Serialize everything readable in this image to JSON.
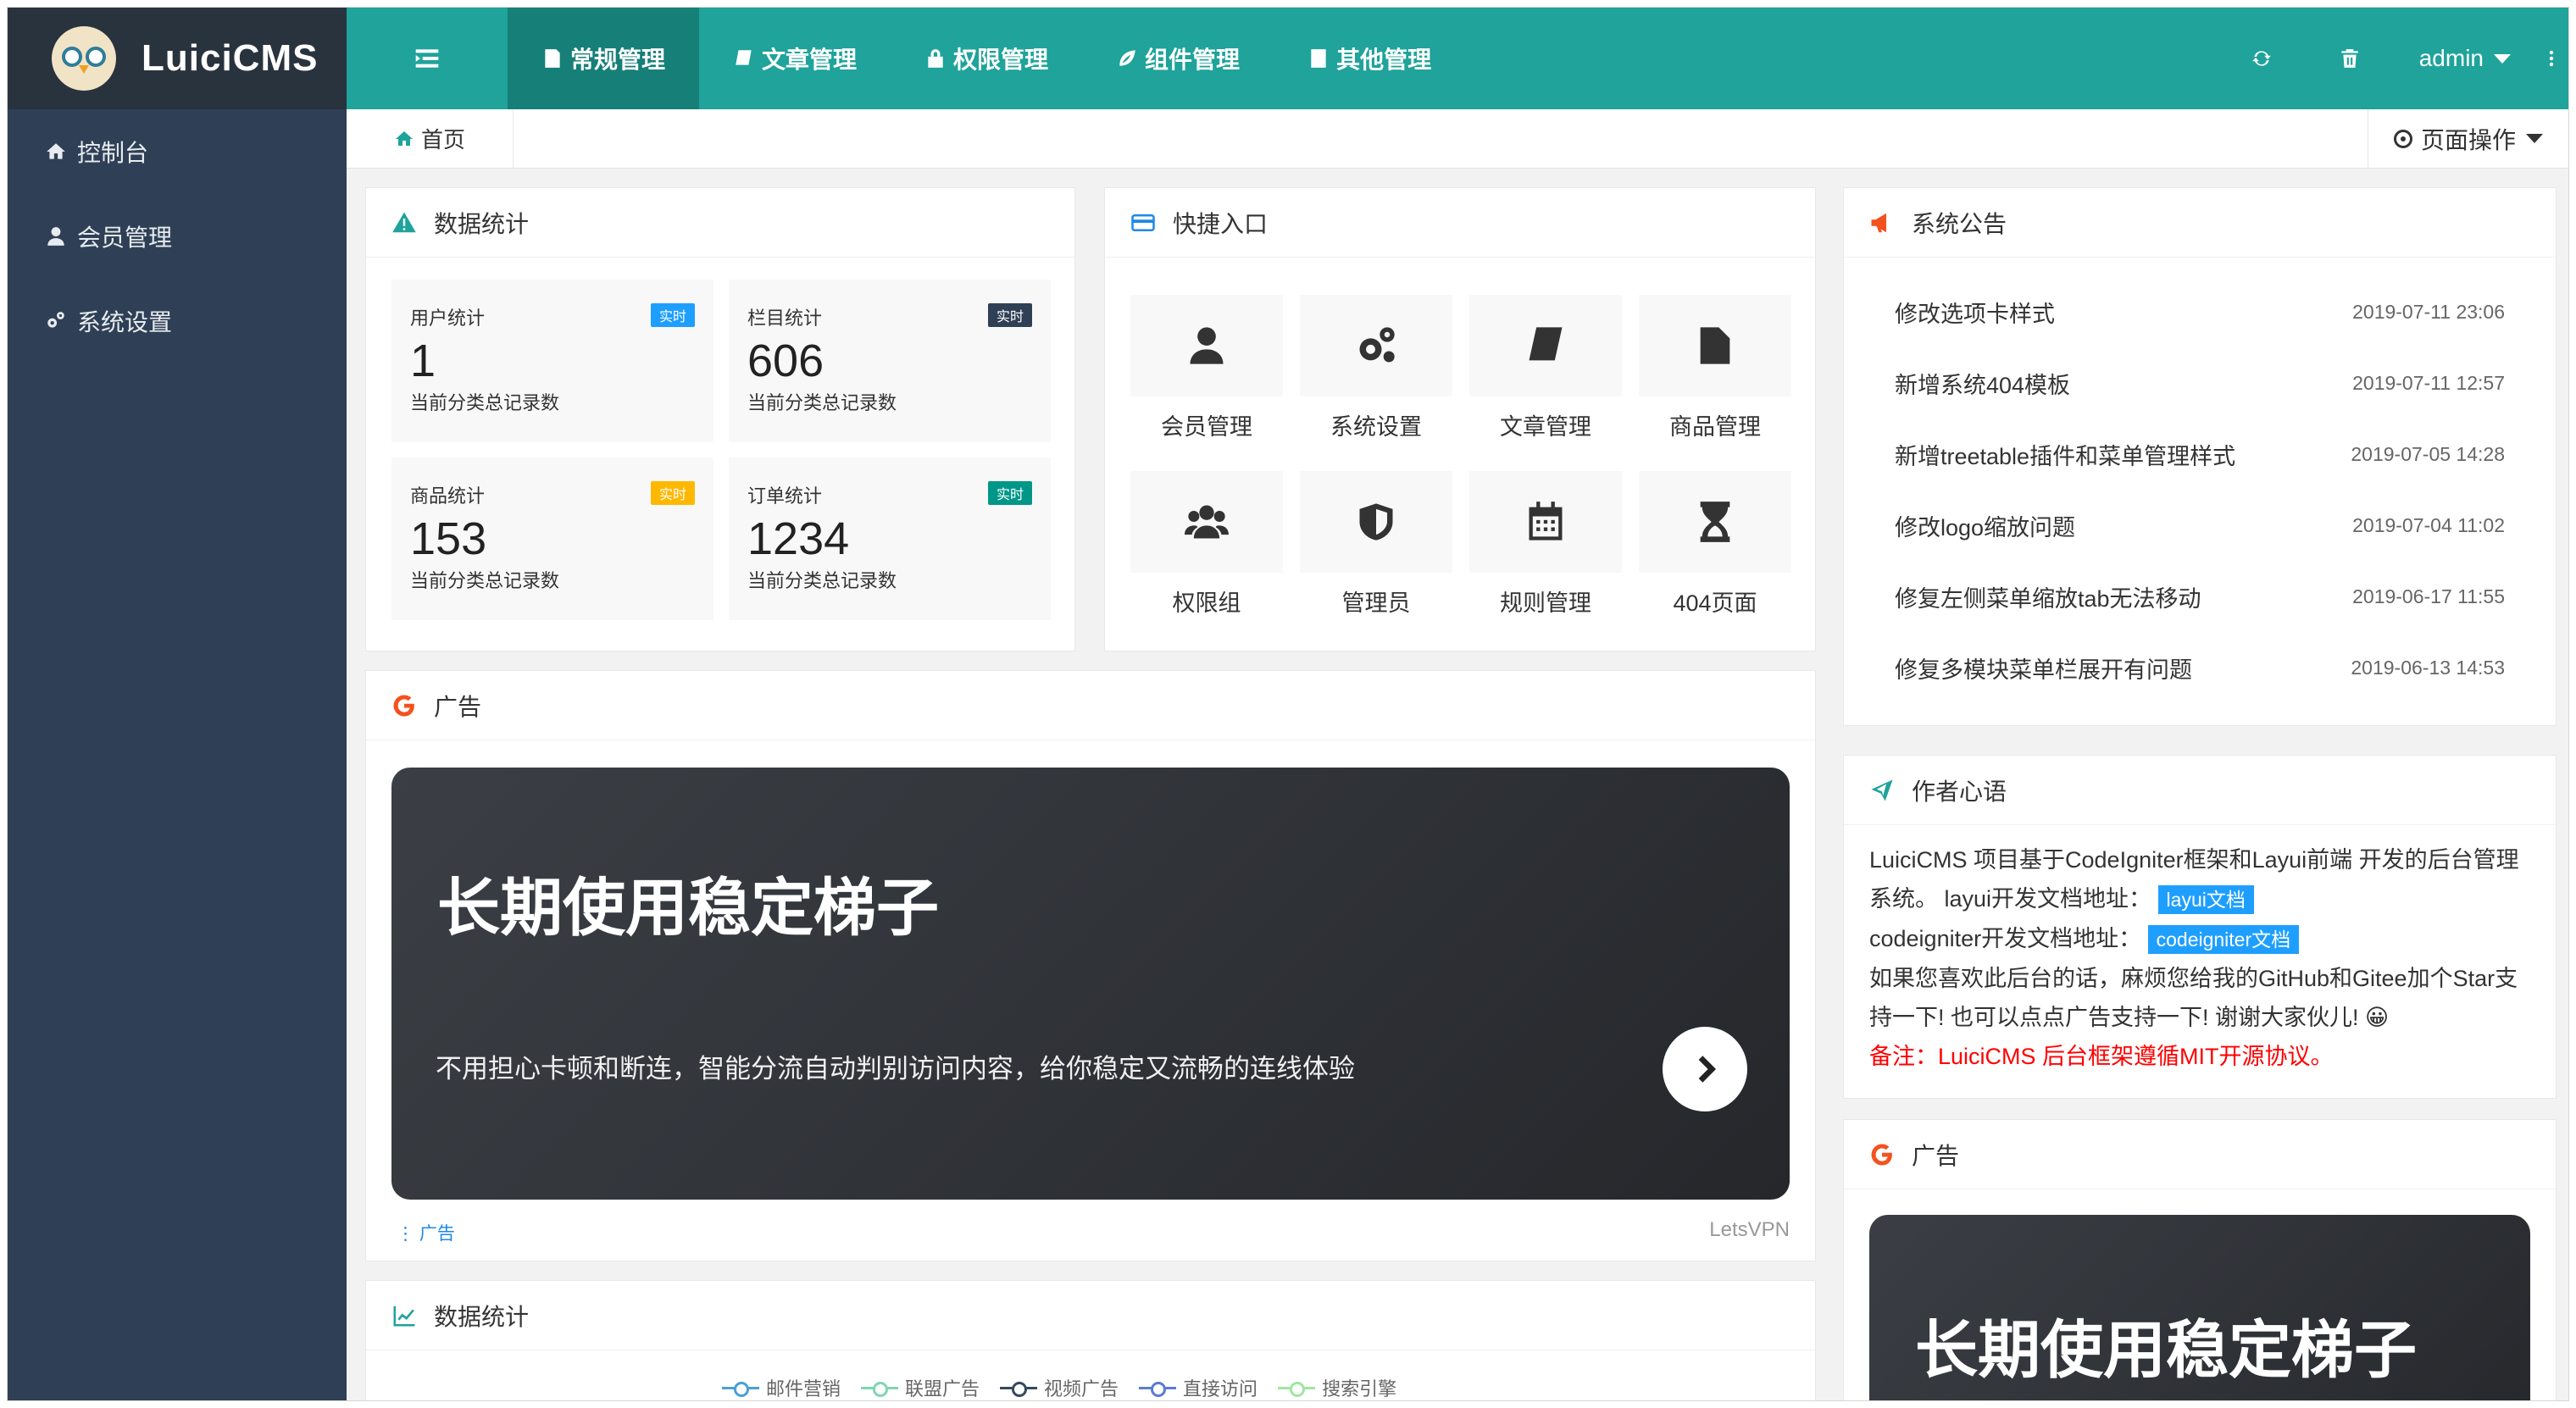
{
  "app": {
    "name": "LuiciCMS"
  },
  "sidebar": {
    "items": [
      {
        "label": "控制台",
        "icon": "home-icon"
      },
      {
        "label": "会员管理",
        "icon": "user-icon"
      },
      {
        "label": "系统设置",
        "icon": "gears-icon"
      }
    ]
  },
  "topbar": {
    "menu": [
      {
        "label": "常规管理",
        "active": true
      },
      {
        "label": "文章管理"
      },
      {
        "label": "权限管理"
      },
      {
        "label": "组件管理"
      },
      {
        "label": "其他管理"
      }
    ],
    "user": "admin"
  },
  "tabs": {
    "home": "首页",
    "page_ops": "页面操作"
  },
  "stats": {
    "title": "数据统计",
    "items": [
      {
        "title": "用户统计",
        "badge": "实时",
        "badge_color": "#1e9fff",
        "value": "1",
        "desc": "当前分类总记录数"
      },
      {
        "title": "栏目统计",
        "badge": "实时",
        "badge_color": "#2f4056",
        "value": "606",
        "desc": "当前分类总记录数"
      },
      {
        "title": "商品统计",
        "badge": "实时",
        "badge_color": "#ffb800",
        "value": "153",
        "desc": "当前分类总记录数"
      },
      {
        "title": "订单统计",
        "badge": "实时",
        "badge_color": "#009688",
        "value": "1234",
        "desc": "当前分类总记录数"
      }
    ]
  },
  "shortcuts": {
    "title": "快捷入口",
    "items": [
      {
        "label": "会员管理",
        "icon": "user-icon"
      },
      {
        "label": "系统设置",
        "icon": "gears-icon"
      },
      {
        "label": "文章管理",
        "icon": "book-icon"
      },
      {
        "label": "商品管理",
        "icon": "file-icon"
      },
      {
        "label": "权限组",
        "icon": "users-icon"
      },
      {
        "label": "管理员",
        "icon": "shield-icon"
      },
      {
        "label": "规则管理",
        "icon": "calendar-icon"
      },
      {
        "label": "404页面",
        "icon": "hourglass-icon"
      }
    ]
  },
  "notices": {
    "title": "系统公告",
    "items": [
      {
        "text": "修改选项卡样式",
        "date": "2019-07-11 23:06"
      },
      {
        "text": "新增系统404模板",
        "date": "2019-07-11 12:57"
      },
      {
        "text": "新增treetable插件和菜单管理样式",
        "date": "2019-07-05 14:28"
      },
      {
        "text": "修改logo缩放问题",
        "date": "2019-07-04 11:02"
      },
      {
        "text": "修复左侧菜单缩放tab无法移动",
        "date": "2019-06-17 11:55"
      },
      {
        "text": "修复多模块菜单栏展开有问题",
        "date": "2019-06-13 14:53"
      }
    ]
  },
  "ad_main": {
    "title": "广告",
    "banner_title": "长期使用稳定梯子",
    "banner_sub": "不用担心卡顿和断连，智能分流自动判别访问内容，给你稳定又流畅的连线体验",
    "foot_left": "广告",
    "foot_right": "LetsVPN"
  },
  "ad_side": {
    "title": "广告",
    "banner_title": "长期使用稳定梯子"
  },
  "author": {
    "title": "作者心语",
    "line1": "LuiciCMS 项目基于CodeIgniter框架和Layui前端 开发的后台管理系统。 layui开发文档地址：",
    "layui_link": "layui文档",
    "line2": "codeigniter开发文档地址：",
    "ci_link": "codeigniter文档",
    "line3": "如果您喜欢此后台的话，麻烦您给我的GitHub和Gitee加个Star支持一下! 也可以点点广告支持一下! 谢谢大家伙儿! 😀",
    "note": "备注：LuiciCMS 后台框架遵循MIT开源协议。"
  },
  "chart_panel": {
    "title": "数据统计",
    "legend": [
      {
        "name": "邮件营销",
        "color": "#4a9fd8"
      },
      {
        "name": "联盟广告",
        "color": "#7fd6b0"
      },
      {
        "name": "视频广告",
        "color": "#34495e"
      },
      {
        "name": "直接访问",
        "color": "#5b7ccf"
      },
      {
        "name": "搜索引擎",
        "color": "#9fe6a0"
      }
    ]
  }
}
